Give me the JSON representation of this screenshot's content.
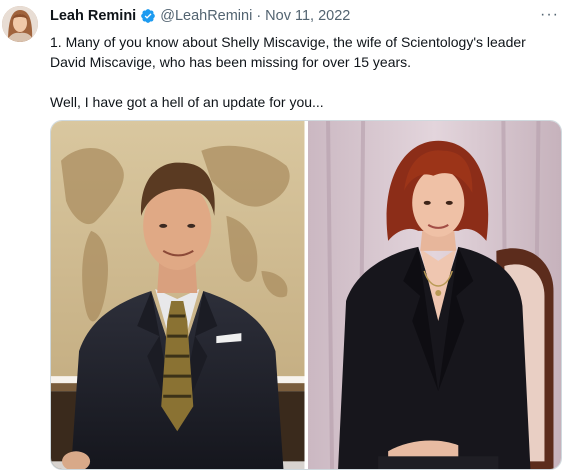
{
  "tweet": {
    "author_name": "Leah Remini",
    "handle": "@LeahRemini",
    "separator": "·",
    "date": "Nov 11, 2022",
    "more_label": "···",
    "text_paragraph_1": "1. Many of you know about Shelly Miscavige, the wife of Scientology's leader David Miscavige, who has been missing for over 15 years.",
    "text_paragraph_2": "Well, I have got a hell of an update for you...",
    "verified_color": "#1d9bf0",
    "media": [
      {
        "icon": "photo-man-suit"
      },
      {
        "icon": "photo-woman-blazer"
      }
    ]
  }
}
